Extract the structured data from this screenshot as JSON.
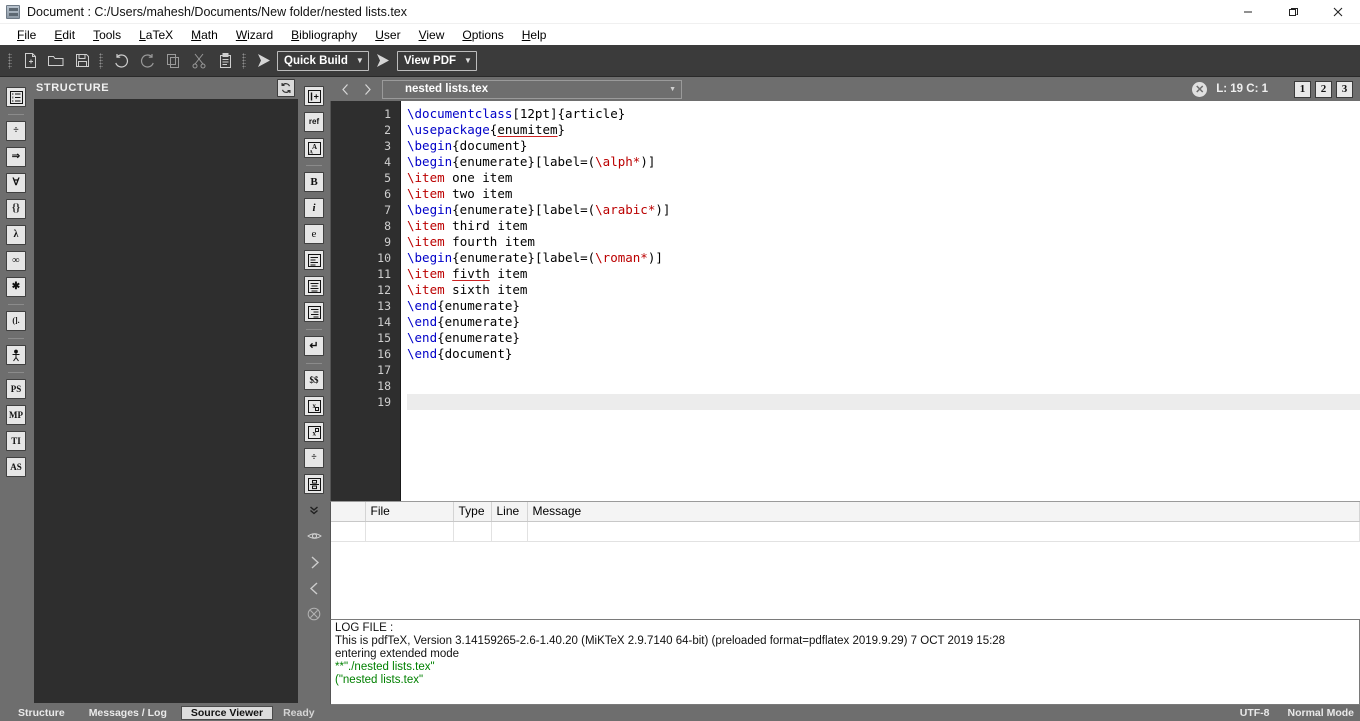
{
  "window": {
    "title": "Document : C:/Users/mahesh/Documents/New folder/nested lists.tex",
    "app_icon": "document-icon",
    "minimize": "minimize-icon",
    "maximize": "restore-icon",
    "close": "close-icon"
  },
  "menubar": {
    "items": [
      {
        "label": "File",
        "mnemonic": "F"
      },
      {
        "label": "Edit",
        "mnemonic": "E"
      },
      {
        "label": "Tools",
        "mnemonic": "T"
      },
      {
        "label": "LaTeX",
        "mnemonic": "L"
      },
      {
        "label": "Math",
        "mnemonic": "M"
      },
      {
        "label": "Wizard",
        "mnemonic": "W"
      },
      {
        "label": "Bibliography",
        "mnemonic": "B"
      },
      {
        "label": "User",
        "mnemonic": "U"
      },
      {
        "label": "View",
        "mnemonic": "V"
      },
      {
        "label": "Options",
        "mnemonic": "O"
      },
      {
        "label": "Help",
        "mnemonic": "H"
      }
    ]
  },
  "toolbar": {
    "buttons": [
      {
        "name": "new-file-icon",
        "tip": "New"
      },
      {
        "name": "open-file-icon",
        "tip": "Open"
      },
      {
        "name": "save-icon",
        "tip": "Save"
      },
      {
        "name": "undo-icon",
        "tip": "Undo"
      },
      {
        "name": "redo-icon",
        "tip": "Redo"
      },
      {
        "name": "copy-icon",
        "tip": "Copy"
      },
      {
        "name": "cut-icon",
        "tip": "Cut"
      },
      {
        "name": "paste-icon",
        "tip": "Paste"
      }
    ],
    "build_run_icon": "run-triangle-icon",
    "build_combo": "Quick Build",
    "view_run_icon": "run-triangle-icon",
    "view_combo": "View PDF",
    "combo_arrow": "▼"
  },
  "left_strip": {
    "items": [
      {
        "name": "structure-list-icon",
        "glyph": "structure"
      },
      {
        "name": "math-operators-icon",
        "glyph": "÷"
      },
      {
        "name": "arrows-icon",
        "glyph": "⇒"
      },
      {
        "name": "logic-symbols-icon",
        "glyph": "∀"
      },
      {
        "name": "delimiters-icon",
        "glyph": "{}"
      },
      {
        "name": "greek-letters-icon",
        "glyph": "λ"
      },
      {
        "name": "misc-symbols-icon",
        "glyph": "∞"
      },
      {
        "name": "stars-symbols-icon",
        "glyph": "✱"
      },
      {
        "name": "brackets-icon",
        "glyph": "(]."
      },
      {
        "name": "symbols-user-icon",
        "glyph": "person"
      },
      {
        "name": "postscript-icon",
        "glyph": "PS"
      },
      {
        "name": "metapost-icon",
        "glyph": "MP"
      },
      {
        "name": "tikz-icon",
        "glyph": "TI"
      },
      {
        "name": "asymptote-icon",
        "glyph": "AS"
      }
    ]
  },
  "right_strip": {
    "items": [
      {
        "name": "insert-section-icon",
        "glyph": "|+"
      },
      {
        "name": "insert-ref-icon",
        "glyph": "ref"
      },
      {
        "name": "font-size-icon",
        "glyph": "A"
      },
      {
        "name": "bold-icon",
        "glyph": "B"
      },
      {
        "name": "italic-icon",
        "glyph": "i"
      },
      {
        "name": "emphasis-icon",
        "glyph": "e"
      },
      {
        "name": "align-left-icon",
        "glyph": "align-left"
      },
      {
        "name": "align-center-icon",
        "glyph": "align-center"
      },
      {
        "name": "align-right-icon",
        "glyph": "align-right"
      },
      {
        "name": "newline-icon",
        "glyph": "↵"
      },
      {
        "name": "math-inline-icon",
        "glyph": "$$"
      },
      {
        "name": "subscript-icon",
        "glyph": "x□"
      },
      {
        "name": "superscript-icon",
        "glyph": "x□"
      },
      {
        "name": "fraction-icon",
        "glyph": "÷"
      },
      {
        "name": "binom-icon",
        "glyph": "binom"
      },
      {
        "name": "more-arrows-icon",
        "glyph": "⌄"
      },
      {
        "name": "preview-eye-icon",
        "glyph": "eye"
      },
      {
        "name": "next-icon",
        "glyph": "›"
      },
      {
        "name": "previous-icon",
        "glyph": "‹"
      },
      {
        "name": "close-preview-icon",
        "glyph": "⊗"
      }
    ]
  },
  "structure_panel": {
    "title": "STRUCTURE",
    "refresh_icon": "refresh-icon"
  },
  "editor_tabs": {
    "back_icon": "chevron-left-icon",
    "forward_icon": "chevron-right-icon",
    "current_file": "nested lists.tex",
    "combo_arrow": "▼",
    "error_badge": "✕",
    "cursor_position": "L: 19  C: 1",
    "view_buttons": [
      "1",
      "2",
      "3"
    ]
  },
  "code": {
    "line_count": 19,
    "current_line": 19,
    "lines": [
      {
        "n": 1,
        "tokens": [
          {
            "t": "\\documentclass",
            "c": "cmd"
          },
          {
            "t": "[12pt]{article}",
            "c": "txt"
          }
        ]
      },
      {
        "n": 2,
        "tokens": [
          {
            "t": "\\usepackage",
            "c": "cmd"
          },
          {
            "t": "{",
            "c": "txt"
          },
          {
            "t": "enumitem",
            "c": "spell"
          },
          {
            "t": "}",
            "c": "txt"
          }
        ]
      },
      {
        "n": 3,
        "tokens": [
          {
            "t": "\\begin",
            "c": "cmd"
          },
          {
            "t": "{document}",
            "c": "txt"
          }
        ]
      },
      {
        "n": 4,
        "tokens": [
          {
            "t": "\\begin",
            "c": "cmd"
          },
          {
            "t": "{enumerate}[label=(",
            "c": "txt"
          },
          {
            "t": "\\alph*",
            "c": "item"
          },
          {
            "t": ")]",
            "c": "txt"
          }
        ]
      },
      {
        "n": 5,
        "tokens": [
          {
            "t": "\\item",
            "c": "item"
          },
          {
            "t": " one item",
            "c": "txt"
          }
        ]
      },
      {
        "n": 6,
        "tokens": [
          {
            "t": "\\item",
            "c": "item"
          },
          {
            "t": " two item",
            "c": "txt"
          }
        ]
      },
      {
        "n": 7,
        "tokens": [
          {
            "t": "\\begin",
            "c": "cmd"
          },
          {
            "t": "{enumerate}[label=(",
            "c": "txt"
          },
          {
            "t": "\\arabic*",
            "c": "item"
          },
          {
            "t": ")]",
            "c": "txt"
          }
        ]
      },
      {
        "n": 8,
        "tokens": [
          {
            "t": "\\item",
            "c": "item"
          },
          {
            "t": " third item",
            "c": "txt"
          }
        ]
      },
      {
        "n": 9,
        "tokens": [
          {
            "t": "\\item",
            "c": "item"
          },
          {
            "t": " fourth item",
            "c": "txt"
          }
        ]
      },
      {
        "n": 10,
        "tokens": [
          {
            "t": "\\begin",
            "c": "cmd"
          },
          {
            "t": "{enumerate}[label=(",
            "c": "txt"
          },
          {
            "t": "\\roman*",
            "c": "item"
          },
          {
            "t": ")]",
            "c": "txt"
          }
        ]
      },
      {
        "n": 11,
        "tokens": [
          {
            "t": "\\item",
            "c": "item"
          },
          {
            "t": " ",
            "c": "txt"
          },
          {
            "t": "fivth",
            "c": "spell"
          },
          {
            "t": " item",
            "c": "txt"
          }
        ]
      },
      {
        "n": 12,
        "tokens": [
          {
            "t": "\\item",
            "c": "item"
          },
          {
            "t": " sixth item",
            "c": "txt"
          }
        ]
      },
      {
        "n": 13,
        "tokens": [
          {
            "t": "\\end",
            "c": "cmd"
          },
          {
            "t": "{enumerate}",
            "c": "txt"
          }
        ]
      },
      {
        "n": 14,
        "tokens": [
          {
            "t": "\\end",
            "c": "cmd"
          },
          {
            "t": "{enumerate}",
            "c": "txt"
          }
        ]
      },
      {
        "n": 15,
        "tokens": [
          {
            "t": "\\end",
            "c": "cmd"
          },
          {
            "t": "{enumerate}",
            "c": "txt"
          }
        ]
      },
      {
        "n": 16,
        "tokens": [
          {
            "t": "\\end",
            "c": "cmd"
          },
          {
            "t": "{document}",
            "c": "txt"
          }
        ]
      },
      {
        "n": 17,
        "tokens": []
      },
      {
        "n": 18,
        "tokens": []
      },
      {
        "n": 19,
        "tokens": []
      }
    ]
  },
  "messages": {
    "columns": [
      "",
      "File",
      "Type",
      "Line",
      "Message"
    ],
    "rows": []
  },
  "log": {
    "lines": [
      {
        "text": "LOG FILE :",
        "green": false
      },
      {
        "text": "This is pdfTeX, Version 3.14159265-2.6-1.40.20 (MiKTeX 2.9.7140 64-bit) (preloaded format=pdflatex 2019.9.29) 7 OCT 2019 15:28",
        "green": false
      },
      {
        "text": "entering extended mode",
        "green": false
      },
      {
        "text": "**\"./nested lists.tex\"",
        "green": true
      },
      {
        "text": "(\"nested lists.tex\"",
        "green": true
      }
    ]
  },
  "statusbar": {
    "tabs": [
      {
        "label": "Structure",
        "active": false
      },
      {
        "label": "Messages / Log",
        "active": false
      },
      {
        "label": "Source Viewer",
        "active": true
      }
    ],
    "status": "Ready",
    "encoding": "UTF-8",
    "mode": "Normal Mode"
  },
  "colors": {
    "chrome": "#6e6e6e",
    "toolbar": "#3b3b3b",
    "panel_dark": "#2e2e2e",
    "editor_bg": "#ffffff",
    "command": "#0000c8",
    "item": "#bb0000",
    "log_green": "#008000",
    "current_line": "#ececec"
  }
}
